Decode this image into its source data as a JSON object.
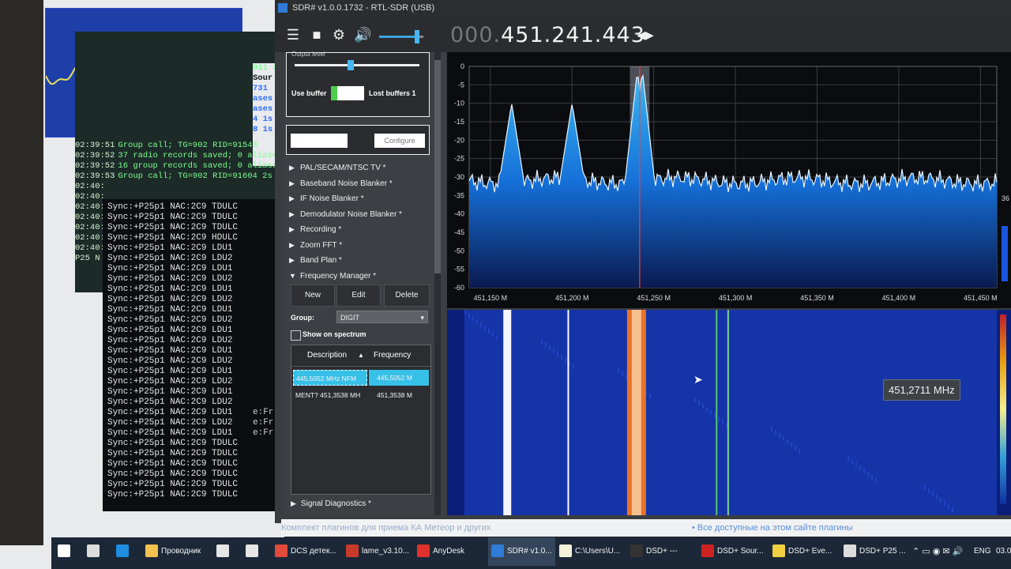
{
  "scope_window": {
    "waveform": "yellow-trace"
  },
  "log_window": {
    "partial_top": [
      "011  3",
      "  Sour",
      "  731",
      "  ases",
      "  ases",
      "  4   1s",
      "  8   1s"
    ],
    "lines": [
      {
        "time": "02:39:51",
        "text": "Group call; TG=902  RID=91543"
      },
      {
        "time": "02:39:52",
        "text": "37 radio records saved; 0 aliases"
      },
      {
        "time": "02:39:52",
        "text": "16 group records saved; 0 aliases"
      },
      {
        "time": "02:39:53",
        "text": "Group call; TG=902  RID=91604  2s"
      },
      {
        "time": "02:40:",
        "text": ""
      },
      {
        "time": "02:40:",
        "text": ""
      },
      {
        "time": "02:40:",
        "text": ""
      },
      {
        "time": "02:40:",
        "text": ""
      },
      {
        "time": "02:40:",
        "text": ""
      },
      {
        "time": "02:40:",
        "text": ""
      },
      {
        "time": "02:40:",
        "text": ""
      },
      {
        "time": "P25 N",
        "text": ""
      }
    ]
  },
  "p25_window": {
    "lines": [
      "Sync:+P25p1  NAC:2C9  TDULC",
      "Sync:+P25p1  NAC:2C9  TDULC",
      "Sync:+P25p1  NAC:2C9  TDULC",
      "Sync:+P25p1  NAC:2C9  HDULC",
      "Sync:+P25p1  NAC:2C9  LDU1",
      "Sync:+P25p1  NAC:2C9  LDU2",
      "Sync:+P25p1  NAC:2C9  LDU1",
      "Sync:+P25p1  NAC:2C9  LDU2",
      "Sync:+P25p1  NAC:2C9  LDU1",
      "Sync:+P25p1  NAC:2C9  LDU2",
      "Sync:+P25p1  NAC:2C9  LDU1",
      "Sync:+P25p1  NAC:2C9  LDU2",
      "Sync:+P25p1  NAC:2C9  LDU1",
      "Sync:+P25p1  NAC:2C9  LDU2",
      "Sync:+P25p1  NAC:2C9  LDU1",
      "Sync:+P25p1  NAC:2C9  LDU2",
      "Sync:+P25p1  NAC:2C9  LDU1",
      "Sync:+P25p1  NAC:2C9  LDU2",
      "Sync:+P25p1  NAC:2C9  LDU1",
      "Sync:+P25p1  NAC:2C9  LDU2",
      "Sync:+P25p1  NAC:2C9  LDU1",
      "Sync:+P25p1  NAC:2C9  LDU2",
      "Sync:+P25p1  NAC:2C9  LDU1",
      "Sync:+P25p1  NAC:2C9  TDULC",
      "Sync:+P25p1  NAC:2C9  TDULC",
      "Sync:+P25p1  NAC:2C9  TDULC",
      "Sync:+P25p1  NAC:2C9  TDULC",
      "Sync:+P25p1  NAC:2C9  TDULC",
      "Sync:+P25p1  NAC:2C9  TDULC"
    ],
    "side_text": [
      "e:Fr",
      "e:Fr",
      "e:Fr"
    ]
  },
  "sdr": {
    "title": "SDR# v1.0.0.1732 - RTL-SDR (USB)",
    "frequency_dim": "000.",
    "frequency_main": "451.241.443",
    "output_level_label": "Output level",
    "volume": 0.85,
    "output_level": 0.45,
    "use_buffer_label": "Use buffer",
    "lost_buffers_label": "Lost buffers 1",
    "configure_label": "Configure",
    "menu": [
      {
        "label": "PAL/SECAM/NTSC TV *",
        "expanded": false
      },
      {
        "label": "Baseband Noise Blanker *",
        "expanded": false
      },
      {
        "label": "IF Noise Blanker *",
        "expanded": false
      },
      {
        "label": "Demodulator Noise Blanker *",
        "expanded": false
      },
      {
        "label": "Recording *",
        "expanded": false
      },
      {
        "label": "Zoom FFT *",
        "expanded": false
      },
      {
        "label": "Band Plan *",
        "expanded": false
      },
      {
        "label": "Frequency Manager *",
        "expanded": true
      }
    ],
    "fm_buttons": {
      "new": "New",
      "edit": "Edit",
      "delete": "Delete"
    },
    "group_label": "Group:",
    "group_value": "DIGIT",
    "show_on_spectrum": "Show on spectrum",
    "table_headers": {
      "description": "Description",
      "frequency": "Frequency"
    },
    "table_rows": [
      {
        "description": "445,5052 MHz NFM",
        "frequency": "445,5052 M",
        "selected": true
      },
      {
        "description": "MENT? 451,3538 MH",
        "frequency": "451,3538 M",
        "selected": false
      }
    ],
    "signal_diagnostics": "Signal Diagnostics *",
    "tooltip": "451,2711 MHz",
    "side_value": "36"
  },
  "chart_data": {
    "type": "line",
    "title": "",
    "xlabel": "",
    "ylabel": "",
    "ylim": [
      -60,
      0
    ],
    "y_ticks": [
      "0",
      "-5",
      "-10",
      "-15",
      "-20",
      "-25",
      "-30",
      "-35",
      "-40",
      "-45",
      "-50",
      "-55",
      "-60"
    ],
    "x_ticks": [
      "451,150 M",
      "451,200 M",
      "451,250 M",
      "451,300 M",
      "451,350 M",
      "451,400 M",
      "451,450 M"
    ],
    "x_tick_values": [
      451.15,
      451.2,
      451.25,
      451.3,
      451.35,
      451.4,
      451.45
    ],
    "xlim": [
      451.137,
      451.46
    ],
    "noise_floor": -31,
    "peaks": [
      {
        "x": 451.163,
        "y": -10
      },
      {
        "x": 451.2,
        "y": -10
      },
      {
        "x": 451.24,
        "y": -1
      },
      {
        "x": 451.243,
        "y": -1
      }
    ],
    "tuned_frequency": 451.2414,
    "grid": true
  },
  "taskbar": {
    "items": [
      {
        "label": "",
        "icon": "windows-icon"
      },
      {
        "label": "",
        "icon": "task-view-icon"
      },
      {
        "label": "",
        "icon": "edge-icon"
      },
      {
        "label": "Проводник",
        "icon": "folder-icon"
      },
      {
        "label": "",
        "icon": "store-icon"
      },
      {
        "label": "",
        "icon": "mail-icon"
      },
      {
        "label": "DCS детек...",
        "icon": "chrome-icon"
      },
      {
        "label": "lame_v3.10...",
        "icon": "winrar-icon"
      },
      {
        "label": "AnyDesk",
        "icon": "anydesk-icon"
      },
      {
        "label": "SDR# v1.0...",
        "icon": "sdr-icon"
      },
      {
        "label": "C:\\Users\\U...",
        "icon": "notepad-icon"
      },
      {
        "label": "DSD+ ---",
        "icon": "cmd-icon"
      },
      {
        "label": "DSD+ Sour...",
        "icon": "wave-icon"
      },
      {
        "label": "DSD+ Eve...",
        "icon": "pen-icon"
      },
      {
        "label": "DSD+ P25 ...",
        "icon": "window-icon"
      }
    ],
    "tray_lang": "ENG",
    "tray_date": "03.0"
  },
  "bottom_strip": {
    "left_link": "Комплект плагинов для приема КА Метеор и других",
    "right_link": "• Все доступные на этом сайте плагины"
  }
}
